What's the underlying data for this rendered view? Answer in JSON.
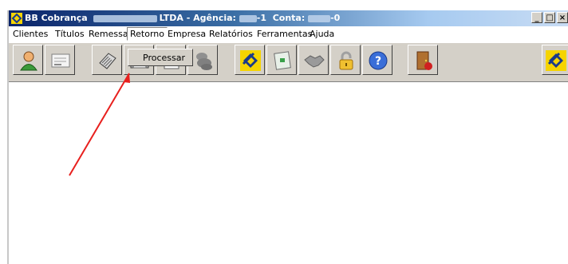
{
  "window": {
    "title_app": "BB Cobrança",
    "title_company": "LTDA",
    "title_agencia_label": "Agência:",
    "title_agencia_value": "-1",
    "title_conta_label": "Conta:",
    "title_conta_value": "-0",
    "controls": [
      "_",
      "□",
      "×"
    ]
  },
  "menubar": {
    "items": [
      "Clientes",
      "Títulos",
      "Remessa",
      "Retorno",
      "Empresa",
      "Relatórios",
      "Ferramentas",
      "Ajuda"
    ],
    "active": "Retorno"
  },
  "dropdown": {
    "items": [
      "Processar"
    ]
  },
  "toolbar": {
    "buttons": [
      "client-icon",
      "document-icon",
      "printer-icon",
      "printer-icon",
      "document-icon",
      "stack-icon",
      "bb-logo-icon",
      "envelope-icon",
      "handshake-icon",
      "padlock-icon",
      "help-icon",
      "exit-door-icon",
      "bb-logo-icon"
    ]
  },
  "colors": {
    "title_start": "#0a246a",
    "bb_yellow": "#f5d400",
    "annotation_arrow": "#e8201e"
  }
}
